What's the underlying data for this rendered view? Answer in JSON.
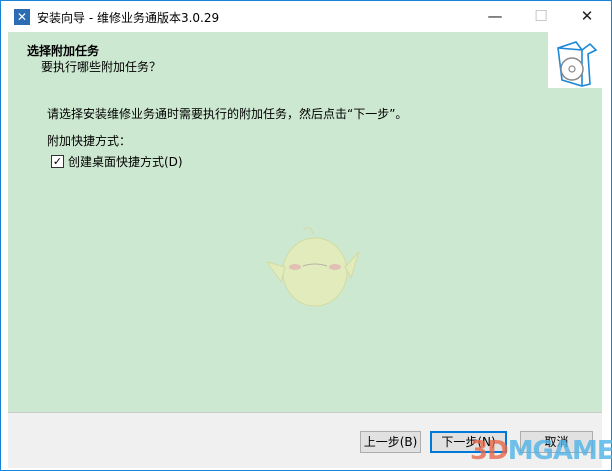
{
  "window": {
    "title": "安装向导 - 维修业务通版本3.0.29",
    "minimize": "—",
    "maximize": "☐",
    "close": "✕"
  },
  "header": {
    "title": "选择附加任务",
    "subtitle": "要执行哪些附加任务？"
  },
  "body": {
    "description": "请选择安装维修业务通时需要执行的附加任务，然后点击“下一步”。",
    "group_label": "附加快捷方式：",
    "checkbox": {
      "label": "创建桌面快捷方式(D)",
      "checked": true
    }
  },
  "buttons": {
    "back": "上一步(B)",
    "next": "下一步(N)",
    "cancel": "取消"
  },
  "watermark": {
    "a": "3D",
    "b": "MGAME"
  }
}
